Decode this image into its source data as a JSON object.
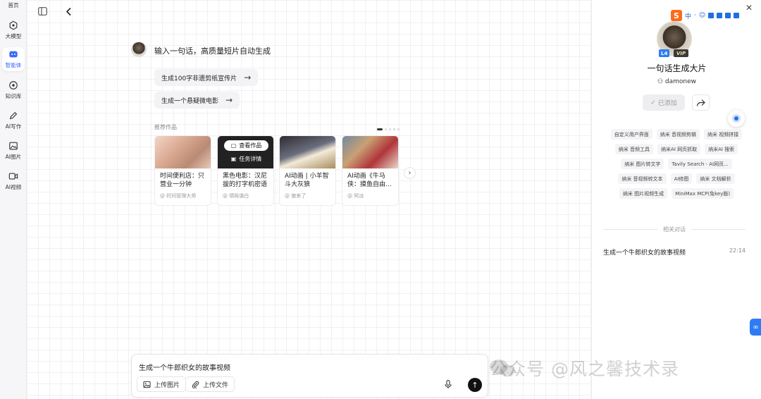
{
  "nav": {
    "items": [
      {
        "label": "首页",
        "icon": "home-icon"
      },
      {
        "label": "大模型",
        "icon": "model-icon"
      },
      {
        "label": "智能体",
        "icon": "agent-icon"
      },
      {
        "label": "知识库",
        "icon": "knowledge-icon"
      },
      {
        "label": "AI写作",
        "icon": "pen-icon"
      },
      {
        "label": "AI图片",
        "icon": "image-icon"
      },
      {
        "label": "AI视频",
        "icon": "video-icon"
      }
    ],
    "active_index": 2,
    "accent": "#3a6bff"
  },
  "chat": {
    "greeting": "输入一句话，高质量短片自动生成",
    "suggestions": [
      "生成100字非遗剪纸宣传片",
      "生成一个悬疑微电影"
    ],
    "recommended_label": "推荐作品",
    "cards": [
      {
        "title": "时间便利店：只营业一分钟",
        "author": "@ 时间管理大师"
      },
      {
        "title": "黑色电影：汉尼拔的打字机密语",
        "author": "@ 晴晗谵白"
      },
      {
        "title": "AI动画 | 小羊智斗大灰狼",
        "author": "@ 狼来了"
      },
      {
        "title": "AI动画《牛马侠：摸鱼自由...",
        "author": "@ 阿派"
      }
    ],
    "card_overlay": {
      "view": "查看作品",
      "details": "任务详情"
    }
  },
  "composer": {
    "text": "生成一个牛郎织女的故事视频",
    "upload_image": "上传图片",
    "upload_file": "上传文件"
  },
  "watermark": "公众号 @风之馨技术录",
  "ime": {
    "lang": "中"
  },
  "agent": {
    "level": "L4",
    "vip": "VIP",
    "name": "一句话生成大片",
    "user": "damonew",
    "added_label": "已添加",
    "tag_rows": [
      [
        "自定义用户界面",
        "纳米 音视频剪辑",
        "纳米 视频拼接"
      ],
      [
        "纳米 音频工具",
        "纳米AI 网页抓取",
        "纳米AI 搜索"
      ],
      [
        "纳米 图片转文字",
        "Tavily Search - AI网页..."
      ],
      [
        "纳米 音视频转文本",
        "AI修图",
        "纳米 文档解析"
      ],
      [
        "纳米 图片视频生成",
        "MiniMax MCP(免key版)"
      ]
    ],
    "related_label": "相关对话",
    "related": [
      {
        "title": "生成一个牛郎织女的故事视频",
        "time": "22:14"
      }
    ]
  }
}
